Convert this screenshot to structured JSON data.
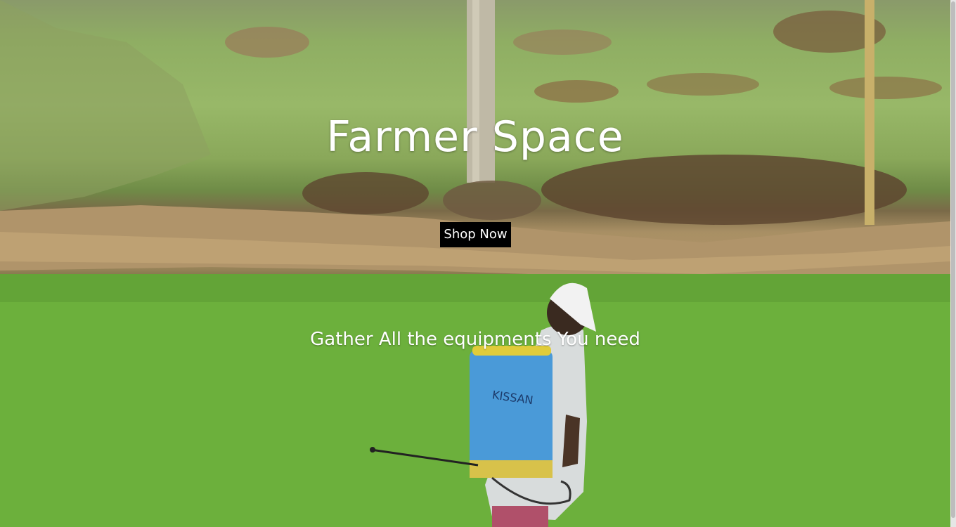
{
  "hero": {
    "title": "Farmer Space",
    "cta_label": "Shop Now",
    "tagline": "Gather All the equipments You need"
  },
  "background": {
    "description_colors": {
      "sky_field": "#98b868",
      "dirt_bund": "#b09468",
      "rice_field": "#6db23c"
    }
  },
  "icons": {
    "scrollbar": "vertical-scrollbar"
  }
}
